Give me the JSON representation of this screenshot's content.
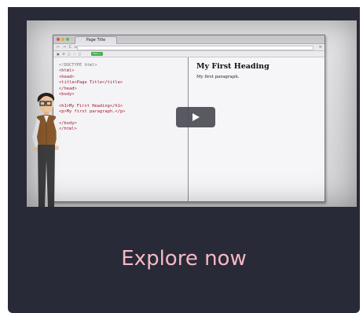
{
  "video": {
    "browser_tab_title": "Page Title",
    "run_button": "Run »",
    "code_lines": [
      {
        "cls": "doctype",
        "text": "<!DOCTYPE html>"
      },
      {
        "cls": "tag",
        "text": "<html>"
      },
      {
        "cls": "tag",
        "text": "<head>"
      },
      {
        "cls": "tag",
        "text": "<title>Page Title</title>"
      },
      {
        "cls": "tag",
        "text": "</head>"
      },
      {
        "cls": "tag",
        "text": "<body>"
      },
      {
        "cls": "txt",
        "text": ""
      },
      {
        "cls": "tag",
        "text": "<h1>My First Heading</h1>"
      },
      {
        "cls": "tag",
        "text": "<p>My first paragraph.</p>"
      },
      {
        "cls": "txt",
        "text": ""
      },
      {
        "cls": "tag",
        "text": "</body>"
      },
      {
        "cls": "tag",
        "text": "</html>"
      }
    ],
    "preview_heading": "My First Heading",
    "preview_paragraph": "My first paragraph."
  },
  "cta": {
    "label": "Explore now"
  },
  "colors": {
    "card_bg": "#282a37",
    "cta_text": "#f6b8c6",
    "play_button": "#4b4c54",
    "code_tag": "#a5192e"
  },
  "icons": {
    "play": "play-icon",
    "menu": "hamburger-menu-icon"
  }
}
